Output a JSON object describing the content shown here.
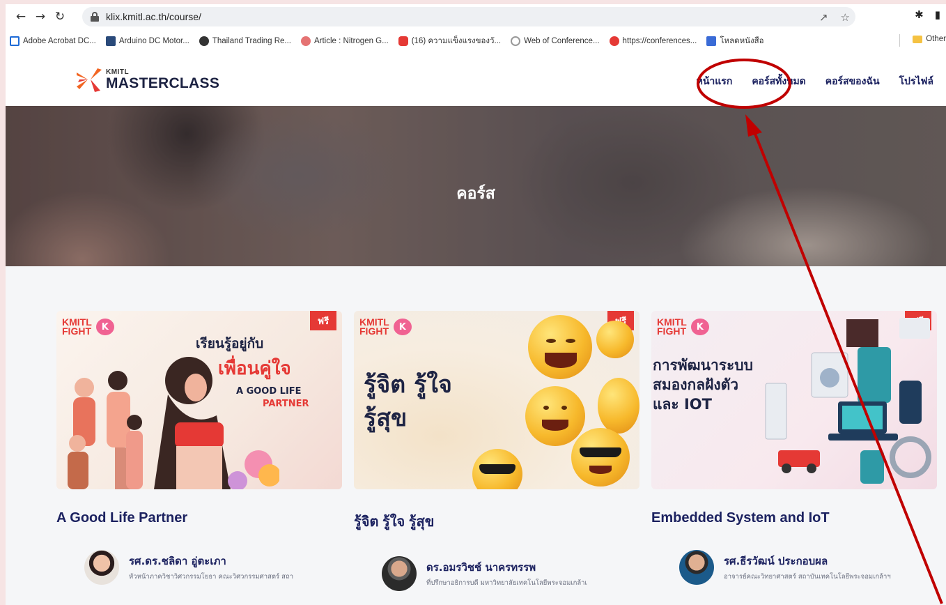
{
  "browser": {
    "url": "klix.kmitl.ac.th/course/",
    "bookmarks": [
      {
        "label": "Adobe Acrobat DC...",
        "color": "#1e6bd6"
      },
      {
        "label": "Arduino DC Motor...",
        "color": "#2a4a7a"
      },
      {
        "label": "Thailand Trading Re...",
        "color": "#333333"
      },
      {
        "label": "Article : Nitrogen G...",
        "color": "#e53935"
      },
      {
        "label": "(16) ความแข็งแรงของวั...",
        "color": "#e53935"
      },
      {
        "label": "Web of Conference...",
        "color": "#777777"
      },
      {
        "label": "https://conferences...",
        "color": "#e53935"
      },
      {
        "label": "โหลดหนังสือ",
        "color": "#3a6bd6"
      }
    ],
    "bookmarks_more": "»",
    "other_bookmarks": "Other"
  },
  "site": {
    "logo_small": "KMITL",
    "logo_big": "MASTERCLASS",
    "menu": [
      "หน้าแรก",
      "คอร์สทั้งหมด",
      "คอร์สของฉัน",
      "โปรไฟล์"
    ]
  },
  "hero": {
    "title": "คอร์ส"
  },
  "courses": [
    {
      "badge": "ฟรี",
      "brand": "KMITL FIGHT",
      "title": "A Good Life Partner",
      "art_lines": [
        "เรียนรู้อยู่กับ",
        "เพื่อนคู่ใจ",
        "A GOOD LIFE",
        "PARTNER"
      ],
      "instructor_name": "รศ.ดร.ชลิดา อู่ตะเภา",
      "instructor_role": "หัวหน้าภาควิชาวิศวกรรมโยธา คณะวิศวกรรมศาสตร์ สถา"
    },
    {
      "badge": "ฟรี",
      "brand": "KMITL FIGHT",
      "title": "รู้จิต รู้ใจ รู้สุข",
      "art_lines": [
        "รู้จิต รู้ใจ",
        "รู้สุข"
      ],
      "instructor_name": "ดร.อมรวิชช์ นาครทรรพ",
      "instructor_role": "ที่ปรึกษาอธิการบดี มหาวิทยาลัยเทคโนโลยีพระจอมเกล้าเ"
    },
    {
      "badge": "ฟรี",
      "brand": "KMITL FIGHT",
      "title": "Embedded System and IoT",
      "art_lines": [
        "การพัฒนาระบบ",
        "สมองกลฝังตัว",
        "และ IOT"
      ],
      "instructor_name": "รศ.ธีรวัฒน์ ประกอบผล",
      "instructor_role": "อาจารย์คณะวิทยาศาสตร์ สถาบันเทคโนโลยีพระจอมเกล้าฯ"
    }
  ],
  "colors": {
    "accent": "#1c2260",
    "badge": "#e53935",
    "annotation": "#c00000"
  }
}
